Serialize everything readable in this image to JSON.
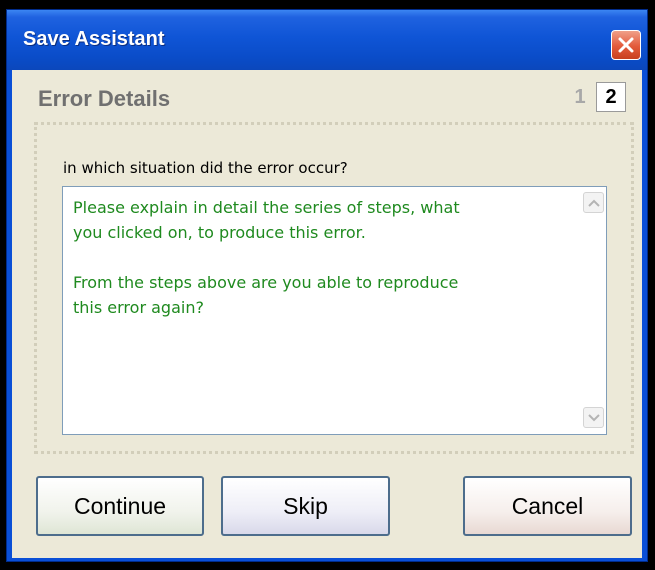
{
  "window": {
    "title": "Save Assistant",
    "close_icon": "close-icon"
  },
  "header": {
    "heading": "Error Details",
    "steps": [
      "1",
      "2"
    ],
    "current_step": "2"
  },
  "form": {
    "question": "in which situation did the error occur?",
    "answer": "Please explain in detail the series of steps, what\nyou clicked on, to produce this error.\n\nFrom the steps above are you able to reproduce\nthis error again?"
  },
  "buttons": {
    "continue": "Continue",
    "skip": "Skip",
    "cancel": "Cancel"
  },
  "colors": {
    "titlebar": "#0a4fd6",
    "client_background": "#ece9d8",
    "answer_text": "#1f8a1f",
    "close_button": "#e35a3b"
  }
}
